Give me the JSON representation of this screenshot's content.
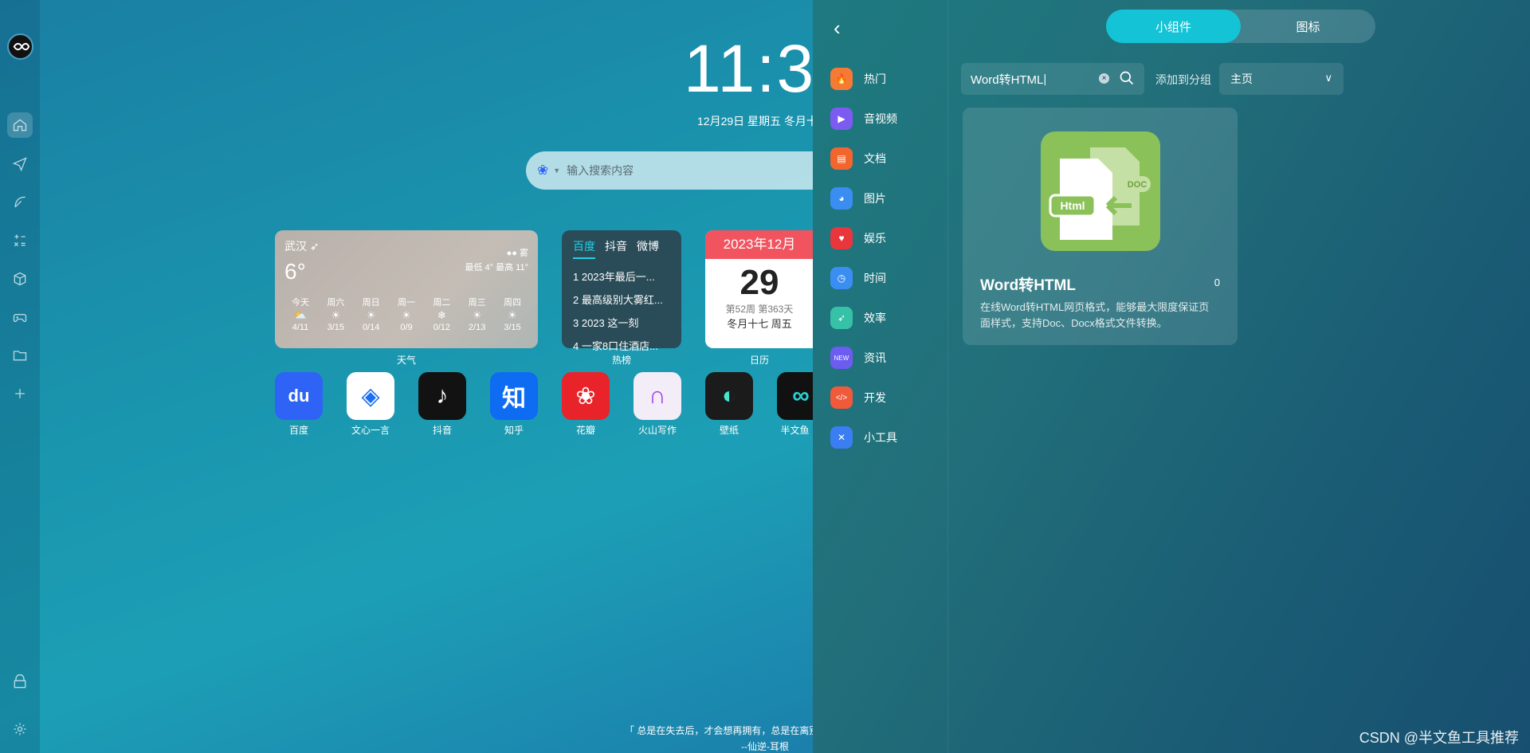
{
  "clock": {
    "time": "11:3",
    "date": "12月29日  星期五  冬月十"
  },
  "search": {
    "placeholder": "输入搜索内容"
  },
  "weather": {
    "city": "武汉",
    "temp": "6°",
    "condition": "雾",
    "range": "最低 4°  最高 11°",
    "days": [
      {
        "name": "今天",
        "icon": "cloud-sun",
        "aqi": "4/11"
      },
      {
        "name": "周六",
        "icon": "sun",
        "aqi": "3/15"
      },
      {
        "name": "周日",
        "icon": "sun",
        "aqi": "0/14"
      },
      {
        "name": "周一",
        "icon": "sun",
        "aqi": "0/9"
      },
      {
        "name": "周二",
        "icon": "snow",
        "aqi": "0/12"
      },
      {
        "name": "周三",
        "icon": "sun",
        "aqi": "2/13"
      },
      {
        "name": "周四",
        "icon": "sun",
        "aqi": "3/15"
      }
    ],
    "label": "天气"
  },
  "hot": {
    "tabs": [
      "百度",
      "抖音",
      "微博"
    ],
    "items": [
      "1 2023年最后一...",
      "2 最高级别大雾红...",
      "3 2023 这一刻",
      "4 一家8口住酒店..."
    ],
    "label": "热榜"
  },
  "calendar": {
    "month": "2023年12月",
    "day": "29",
    "week": "第52周  第363天",
    "lunar": "冬月十七  周五",
    "label": "日历"
  },
  "apps": [
    {
      "name": "百度",
      "glyph": "du",
      "color": "#2e63f5"
    },
    {
      "name": "文心一言",
      "glyph": "◈",
      "color": "#ffffff"
    },
    {
      "name": "抖音",
      "glyph": "♪",
      "color": "#121212"
    },
    {
      "name": "知乎",
      "glyph": "知",
      "color": "#0d6cf2"
    },
    {
      "name": "花瓣",
      "glyph": "❀",
      "color": "#e8232a"
    },
    {
      "name": "火山写作",
      "glyph": "∩",
      "color": "#f2edf7"
    },
    {
      "name": "壁纸",
      "glyph": "◐",
      "color": "#1b1b1b"
    },
    {
      "name": "半文鱼",
      "glyph": "∞",
      "color": "#111111"
    }
  ],
  "quote": {
    "line1": "「 总是在失去后，才会想再拥有，总是在离别",
    "line2": "--仙逆-耳根"
  },
  "panel": {
    "tabs": [
      "小组件",
      "图标"
    ],
    "categories": [
      {
        "name": "热门",
        "icon": "fire-icon",
        "color": "#f57a34"
      },
      {
        "name": "音视频",
        "icon": "play-icon",
        "color": "#7c5cf0"
      },
      {
        "name": "文档",
        "icon": "doc-icon",
        "color": "#f2662e"
      },
      {
        "name": "图片",
        "icon": "image-icon",
        "color": "#3a8ef2"
      },
      {
        "name": "娱乐",
        "icon": "game-icon",
        "color": "#e8373c"
      },
      {
        "name": "时间",
        "icon": "clock-icon",
        "color": "#3a8ef2"
      },
      {
        "name": "效率",
        "icon": "rocket-icon",
        "color": "#36c2a6"
      },
      {
        "name": "资讯",
        "icon": "news-icon",
        "color": "#6c5cf0"
      },
      {
        "name": "开发",
        "icon": "code-icon",
        "color": "#f05a3a"
      },
      {
        "name": "小工具",
        "icon": "tool-icon",
        "color": "#3a7ef2"
      }
    ],
    "search_value": "Word转HTML",
    "add_label": "添加到分组",
    "group": "主页",
    "result": {
      "title": "Word转HTML",
      "count": "0",
      "desc": "在线Word转HTML网页格式，能够最大限度保证页面样式，支持Doc、Docx格式文件转换。",
      "icon_text_html": "Html",
      "icon_text_doc": "DOC"
    }
  },
  "watermark": "CSDN @半文鱼工具推荐"
}
